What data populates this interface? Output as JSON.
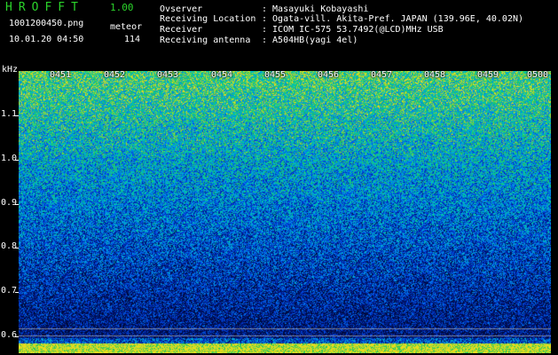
{
  "header": {
    "app_name": "HROFFT",
    "version": "1.00",
    "file_name": "1001200450.png",
    "datetime": "10.01.20 04:50",
    "meteor_label": "meteor",
    "meteor_count": "114"
  },
  "station": {
    "observer_label": "Ovserver",
    "observer_value": ": Masayuki Kobayashi",
    "location_label": "Receiving Location",
    "location_value": ": Ogata-vill. Akita-Pref. JAPAN (139.96E, 40.02N)",
    "receiver_label": "Receiver",
    "receiver_value": ": ICOM IC-575 53.7492(@LCD)MHz USB",
    "antenna_label": "Receiving antenna",
    "antenna_value": ": A504HB(yagi 4el)"
  },
  "spectrogram": {
    "freq_unit": "kHz",
    "freq_labels": [
      "1.1",
      "1.0",
      "0.9",
      "0.8",
      "0.7",
      "0.6"
    ],
    "time_labels": [
      "0451",
      "0452",
      "0453",
      "0454",
      "0455",
      "0456",
      "0457",
      "0458",
      "0459",
      "0500"
    ]
  },
  "colors": {
    "title_green": "#2bd42b",
    "background": "#000000"
  }
}
